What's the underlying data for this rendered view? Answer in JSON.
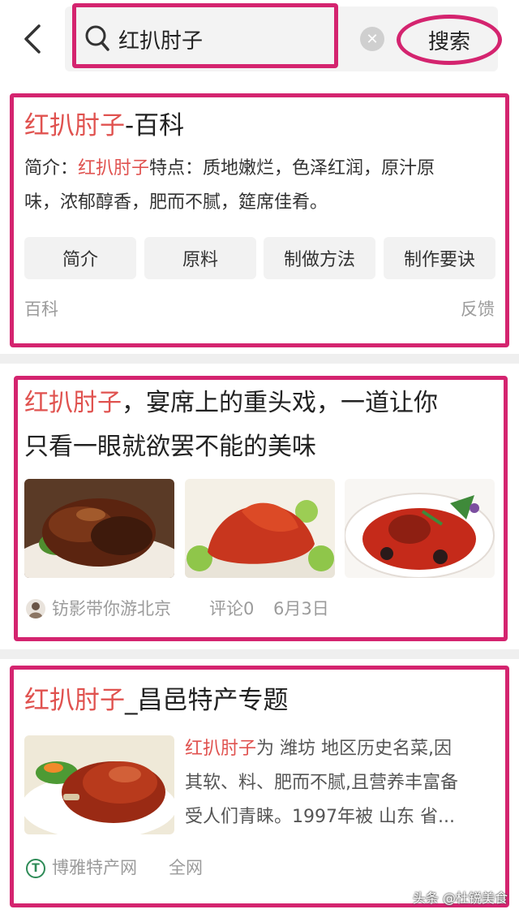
{
  "search": {
    "query": "红扒肘子",
    "button_label": "搜索",
    "clear_glyph": "✕"
  },
  "results": [
    {
      "title_highlight": "红扒肘子",
      "title_rest": "-百科",
      "intro_label": "简介：",
      "intro_highlight": "红扒肘子",
      "intro_rest_line1": "特点：质地嫩烂，色泽红润，原汁原",
      "intro_line2": "味，浓郁醇香，肥而不腻，筵席佳肴。",
      "chips": [
        "简介",
        "原料",
        "制做方法",
        "制作要诀"
      ],
      "source": "百科",
      "feedback": "反馈"
    },
    {
      "title_highlight": "红扒肘子",
      "title_rest_line1": "，宴席上的重头戏，一道让你",
      "title_line2": "只看一眼就欲罢不能的美味",
      "author": "钫影带你游北京",
      "comments": "评论0",
      "date": "6月3日"
    },
    {
      "title_highlight": "红扒肘子",
      "title_rest": "_昌邑特产专题",
      "snippet_highlight": "红扒肘子",
      "snippet_rest_line1": "为 潍坊 地区历史名菜,因",
      "snippet_line2": "其软、料、肥而不腻,且营养丰富备",
      "snippet_line3": "受人们青睐。1997年被 山东 省...",
      "source": "博雅特产网",
      "scope": "全网",
      "source_icon_letter": "T"
    }
  ],
  "watermark": "头条 @杜锐美食",
  "colors": {
    "accent": "#d4246f",
    "keyword": "#e0524f",
    "meta": "#9b9b9b"
  },
  "icons": [
    "back-arrow-icon",
    "search-icon",
    "clear-icon",
    "avatar-icon",
    "site-logo-icon"
  ]
}
